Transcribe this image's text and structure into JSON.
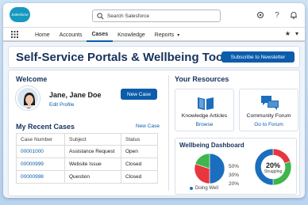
{
  "app": {
    "logo_text": "Salesforce",
    "search_placeholder": "Search Salesforce"
  },
  "nav": {
    "items": [
      {
        "label": "Home"
      },
      {
        "label": "Accounts"
      },
      {
        "label": "Cases",
        "active": true
      },
      {
        "label": "Knowledge"
      },
      {
        "label": "Reports"
      }
    ],
    "reports_chevron": "▾"
  },
  "header": {
    "title": "Self-Service Portals & Wellbeing Tools",
    "subscribe_label": "Subscribe to Newsletter"
  },
  "welcome": {
    "title": "Welcome",
    "user_name": "Jane, Jane Doe",
    "edit_profile": "Edit Profile",
    "new_case_button": "New Case"
  },
  "cases": {
    "title": "My Recent Cases",
    "new_case_link": "New Case",
    "columns": [
      "Case Number",
      "Subject",
      "Status"
    ],
    "rows": [
      {
        "number": "00001000",
        "subject": "Assistance Request",
        "status": "Open"
      },
      {
        "number": "00000999",
        "subject": "Website Issue",
        "status": "Closed"
      },
      {
        "number": "00000998",
        "subject": "Question",
        "status": "Closed"
      }
    ]
  },
  "resources": {
    "title": "Your Resources",
    "cards": [
      {
        "title": "Knowledge Articles",
        "link": "Browse",
        "icon": "book-icon"
      },
      {
        "title": "Community Forum",
        "link": "Go to Forum",
        "icon": "chat-bubbles-icon"
      }
    ]
  },
  "dashboard": {
    "title": "Wellbeing Dashboard",
    "pie_percents": [
      "50%",
      "30%",
      "20%"
    ],
    "pie_legend": "Doing Well",
    "donut_percent": "20%",
    "donut_label": "Struggling"
  },
  "chart_data": [
    {
      "type": "pie",
      "categories": [
        "",
        "",
        ""
      ],
      "values": [
        50,
        30,
        20
      ],
      "colors": [
        "#1b6ebd",
        "#e8363f",
        "#3fb54b"
      ],
      "legend": [
        "Doing Well"
      ]
    },
    {
      "type": "pie",
      "categories": [
        "Struggling"
      ],
      "values": [
        20,
        30,
        50
      ],
      "colors": [
        "#e8363f",
        "#3fb54b",
        "#1b6ebd"
      ],
      "center_label": "20%"
    }
  ],
  "colors": {
    "brand": "#0b5cab",
    "logo": "#1798c1",
    "title": "#16325c"
  }
}
